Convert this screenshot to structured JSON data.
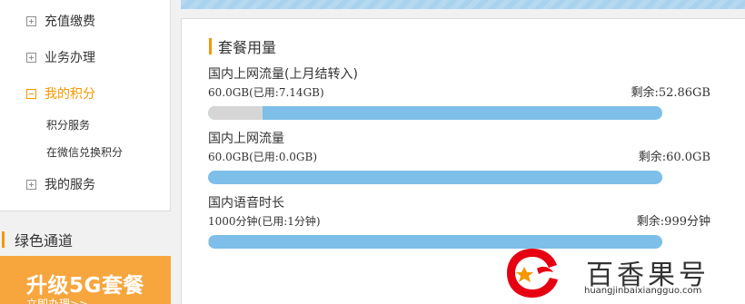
{
  "sidebar": {
    "items": [
      {
        "label": "充值缴费",
        "state": "collapsed"
      },
      {
        "label": "业务办理",
        "state": "collapsed"
      },
      {
        "label": "我的积分",
        "state": "expanded"
      },
      {
        "label": "我的服务",
        "state": "collapsed"
      }
    ],
    "subitems": [
      "积分服务",
      "在微信兑换积分"
    ],
    "green_channel": "绿色通道",
    "promo": {
      "title": "升级5G套餐",
      "subtitle": "立即办理>>"
    }
  },
  "main": {
    "section_title": "套餐用量",
    "usages": [
      {
        "name": "国内上网流量(上月结转入)",
        "used": "60.0GB(已用:7.14GB)",
        "remaining": "剩余:52.86GB",
        "used_fraction": 0.119
      },
      {
        "name": "国内上网流量",
        "used": "60.0GB(已用:0.0GB)",
        "remaining": "剩余:60.0GB",
        "used_fraction": 0
      },
      {
        "name": "国内语音时长",
        "used": "1000分钟(已用:1分钟)",
        "remaining": "剩余:999分钟",
        "used_fraction": 0.001
      }
    ]
  },
  "watermark": {
    "brand": "百香果号",
    "url": "huangjinbaixiangguo.com"
  },
  "colors": {
    "accent": "#f39800",
    "progress_track": "#7dbfe8",
    "progress_used": "#d6d6d6",
    "promo_bg": "#f7a63e"
  }
}
